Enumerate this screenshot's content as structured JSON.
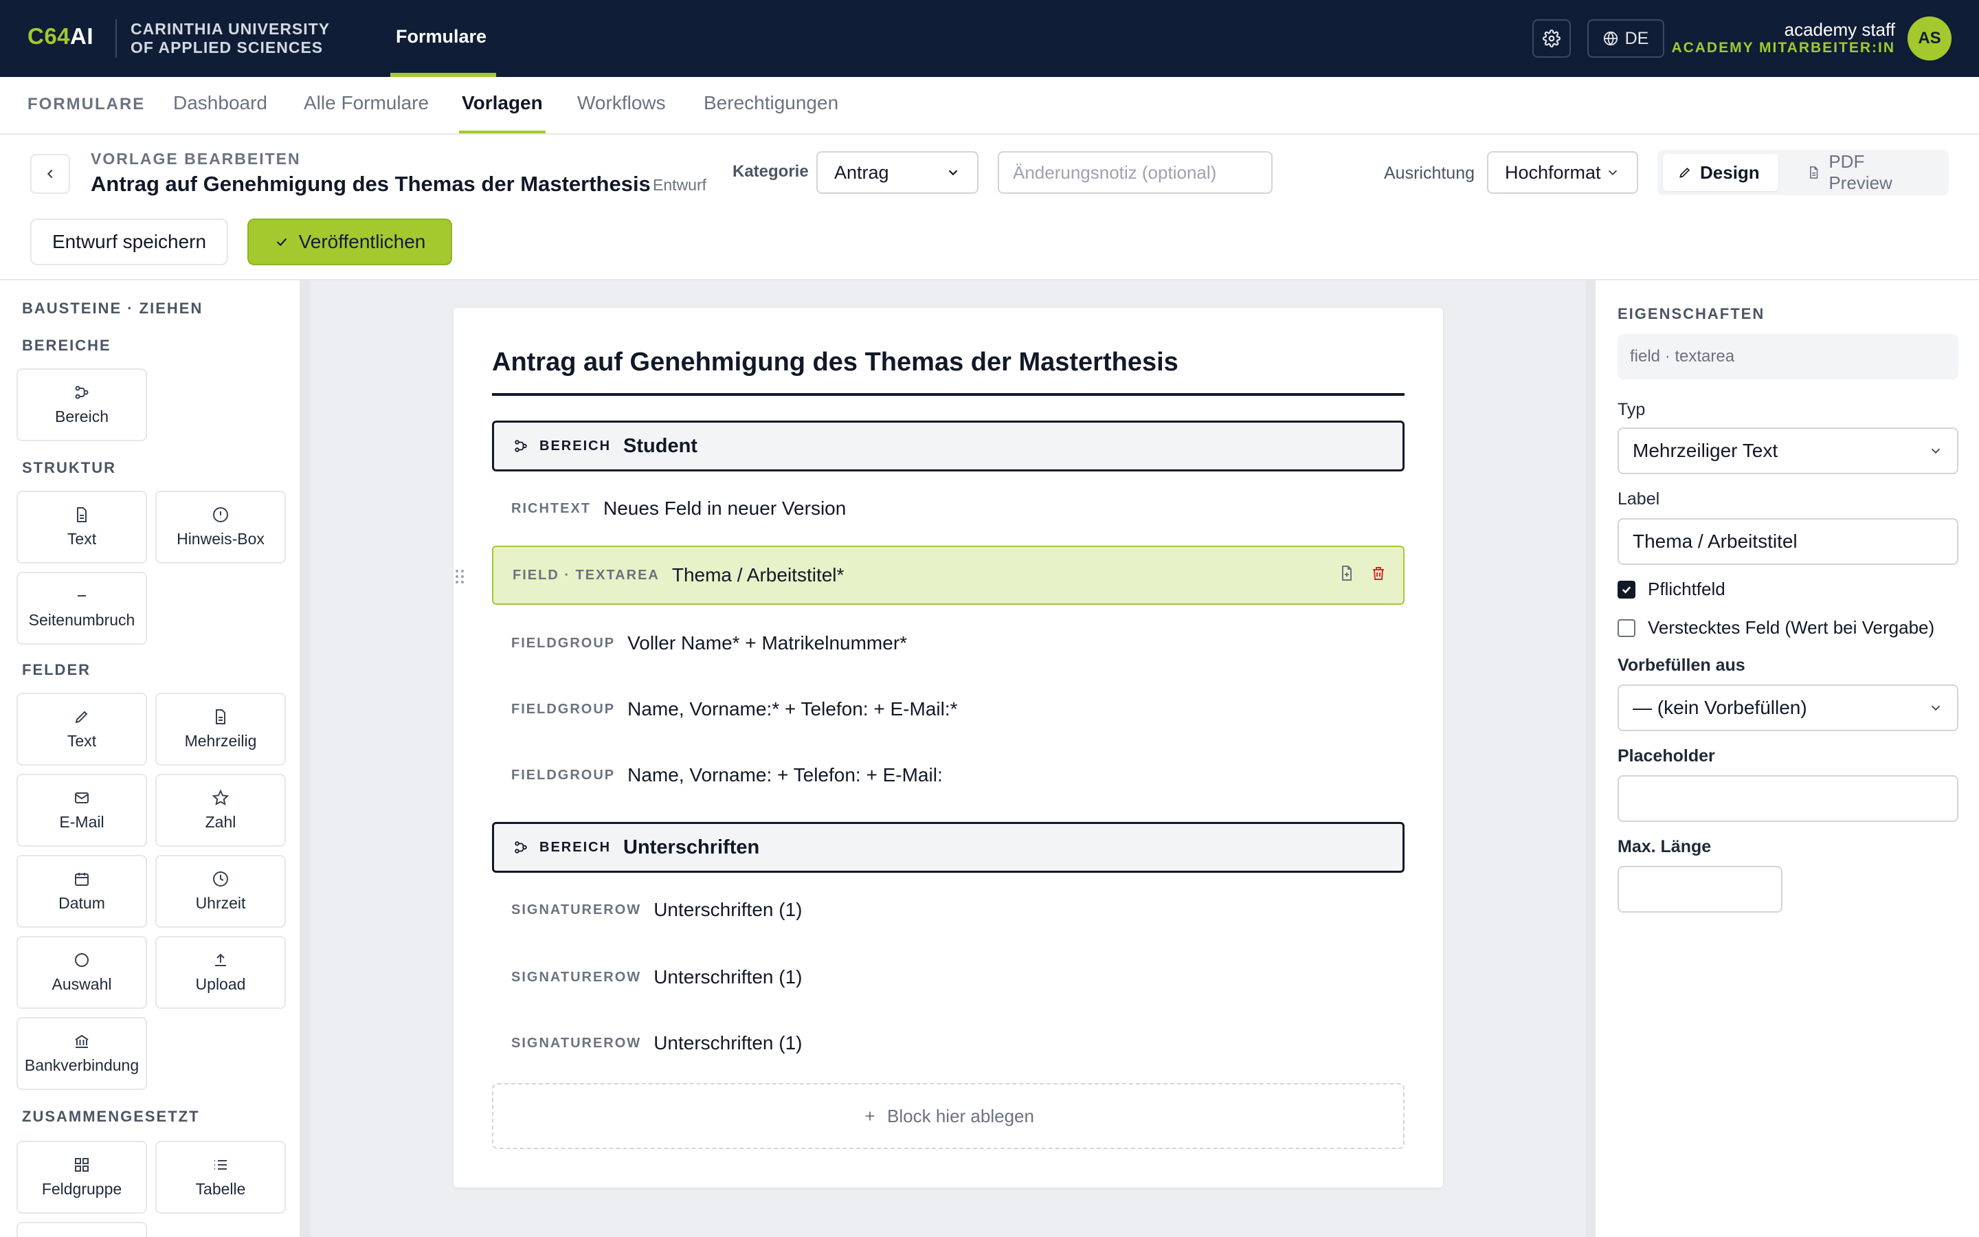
{
  "topbar": {
    "logo_main": "C64",
    "logo_suffix": "AI",
    "university_line1": "CARINTHIA UNIVERSITY",
    "university_line2": "OF APPLIED SCIENCES",
    "nav_label": "Formulare",
    "language": "DE",
    "user_name": "academy staff",
    "user_role": "ACADEMY MITARBEITER:IN",
    "avatar_initials": "AS"
  },
  "subnav": {
    "label": "FORMULARE",
    "tabs": [
      {
        "label": "Dashboard"
      },
      {
        "label": "Alle Formulare"
      },
      {
        "label": "Vorlagen",
        "active": true
      },
      {
        "label": "Workflows"
      },
      {
        "label": "Berechtigungen"
      }
    ]
  },
  "editor": {
    "eyebrow": "VORLAGE BEARBEITEN",
    "title": "Antrag auf Genehmigung des Themas der Masterthesis",
    "status": "· Entwurf",
    "category_label": "Kategorie",
    "category_value": "Antrag",
    "change_note_placeholder": "Änderungsnotiz (optional)",
    "orientation_label": "Ausrichtung",
    "orientation_value": "Hochformat",
    "view_design": "Design",
    "view_pdf": "PDF Preview",
    "save_draft": "Entwurf speichern",
    "publish": "Veröffentlichen"
  },
  "palette": {
    "heading": "BAUSTEINE · ZIEHEN",
    "groups": {
      "areas": "BEREICHE",
      "structure": "STRUKTUR",
      "fields": "FELDER",
      "composite": "ZUSAMMENGESETZT"
    },
    "items": {
      "bereich": "Bereich",
      "text_struct": "Text",
      "hinweis": "Hinweis-Box",
      "seitenumbruch": "Seitenumbruch",
      "text_field": "Text",
      "mehrzeilig": "Mehrzeilig",
      "email": "E-Mail",
      "zahl": "Zahl",
      "datum": "Datum",
      "uhrzeit": "Uhrzeit",
      "auswahl": "Auswahl",
      "upload": "Upload",
      "bank": "Bankverbindung",
      "feldgruppe": "Feldgruppe",
      "tabelle": "Tabelle"
    }
  },
  "canvas": {
    "sheet_title": "Antrag auf Genehmigung des Themas der Masterthesis",
    "blocks": [
      {
        "type": "BEREICH",
        "label": "Student"
      },
      {
        "type": "RICHTEXT",
        "label": "Neues Feld in neuer Version"
      },
      {
        "type": "FIELD · TEXTAREA",
        "label": "Thema / Arbeitstitel*"
      },
      {
        "type": "FIELDGROUP",
        "label": "Voller Name* + Matrikelnummer*"
      },
      {
        "type": "FIELDGROUP",
        "label": "Name, Vorname:* + Telefon: + E-Mail:*"
      },
      {
        "type": "FIELDGROUP",
        "label": "Name, Vorname: + Telefon: + E-Mail:"
      },
      {
        "type": "BEREICH",
        "label": "Unterschriften"
      },
      {
        "type": "SIGNATUREROW",
        "label": "Unterschriften (1)"
      },
      {
        "type": "SIGNATUREROW",
        "label": "Unterschriften (1)"
      },
      {
        "type": "SIGNATUREROW",
        "label": "Unterschriften (1)"
      }
    ],
    "drop_zone": "Block hier ablegen"
  },
  "properties": {
    "heading": "EIGENSCHAFTEN",
    "meta": "field · textarea",
    "type_label": "Typ",
    "type_value": "Mehrzeiliger Text",
    "label_label": "Label",
    "label_value": "Thema / Arbeitstitel",
    "required_label": "Pflichtfeld",
    "required_checked": true,
    "hidden_label": "Verstecktes Feld (Wert bei Vergabe)",
    "hidden_checked": false,
    "prefill_label": "Vorbefüllen aus",
    "prefill_value": "— (kein Vorbefüllen)",
    "placeholder_label": "Placeholder",
    "placeholder_value": "",
    "maxlen_label": "Max. Länge",
    "maxlen_value": ""
  },
  "colors": {
    "topbar": "#0f1d36",
    "accent": "#a3c92e",
    "selected_block": "#e8f2c8",
    "danger": "#dc2626"
  }
}
